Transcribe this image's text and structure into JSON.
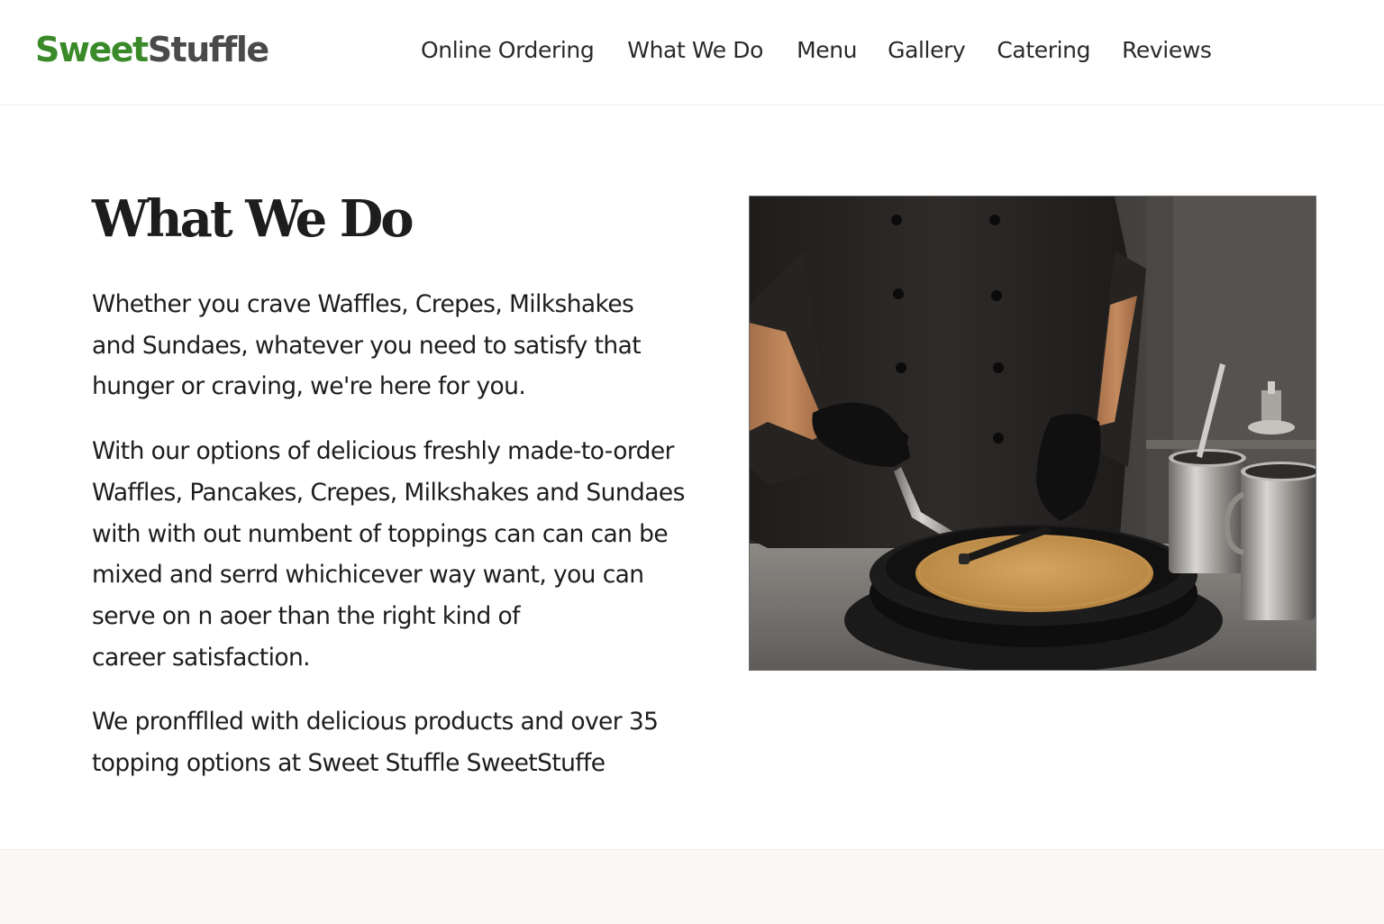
{
  "header": {
    "logo_part1": "Sweet",
    "logo_part2": "Stuffle",
    "nav": [
      {
        "label": "Online Ordering"
      },
      {
        "label": "What We Do"
      },
      {
        "label": "Menu"
      },
      {
        "label": "Gallery"
      },
      {
        "label": "Catering"
      },
      {
        "label": "Reviews"
      }
    ]
  },
  "main": {
    "title": "What We Do",
    "paragraphs": [
      {
        "lines": [
          "Whether you crave Waffles, Crepes, Milkshakes",
          "and Sundaes, whatever you need to satisfy that",
          "hunger or craving, we're here for you."
        ]
      },
      {
        "lines": [
          "With our options of delicious freshly made-to-order",
          "Waffles, Pancakes, Crepes, Milkshakes and Sundaes",
          "with with out numbent of toppings can can can be",
          "mixed and serrd whichicever way want, you can",
          "serve on n aoer than the right kind of",
          "career satisfaction."
        ]
      },
      {
        "lines": [
          "We pronfflled with delicious products and over 35",
          "topping options at Sweet Stuffle SweetStuffe"
        ]
      }
    ]
  },
  "colors": {
    "brand_green": "#3a8a2a",
    "brand_gray": "#4a4a4a",
    "footer_band": "#faf9f7"
  },
  "icons": {
    "hero": "chef-spreading-crepe-photo"
  }
}
